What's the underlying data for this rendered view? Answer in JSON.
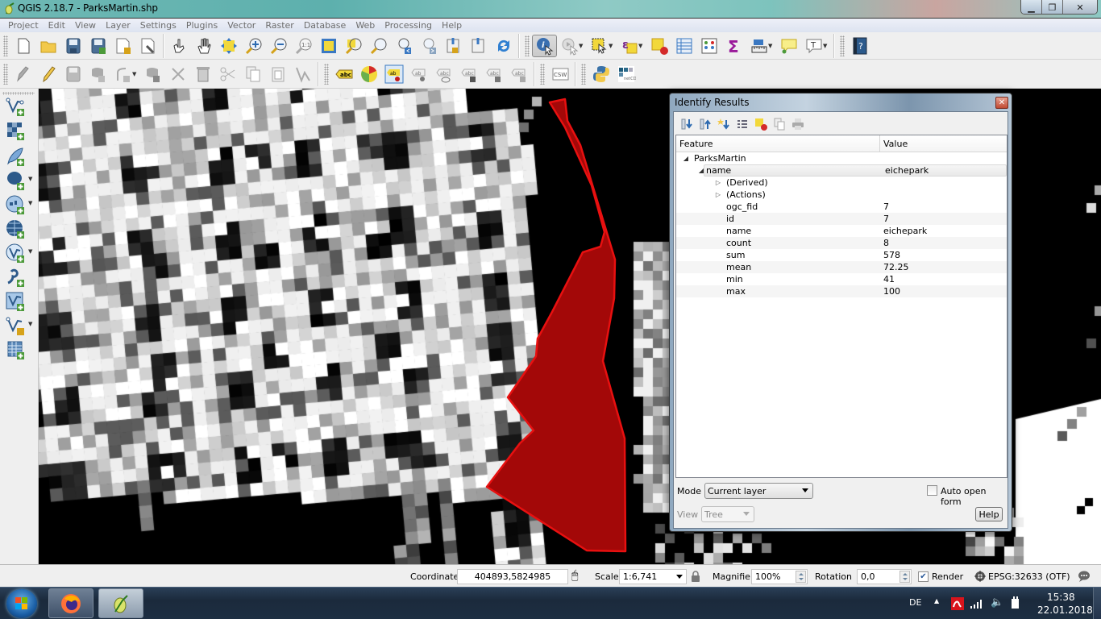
{
  "window": {
    "title": "QGIS 2.18.7 - ParksMartin.shp",
    "controls": [
      "minimize",
      "restore",
      "close"
    ]
  },
  "menubar": {
    "items": [
      "Project",
      "Edit",
      "View",
      "Layer",
      "Settings",
      "Plugins",
      "Vector",
      "Raster",
      "Database",
      "Web",
      "Processing",
      "Help"
    ]
  },
  "toolbar_top": {
    "icons": [
      "new-project-icon",
      "open-project-icon",
      "save-project-icon",
      "save-as-icon",
      "new-print-composer-icon",
      "composer-manager-icon",
      "touch-zoom-pan-icon",
      "pan-icon",
      "pan-to-selection-icon",
      "zoom-in-icon",
      "zoom-out-icon",
      "zoom-native-icon",
      "zoom-full-icon",
      "zoom-to-selection-icon",
      "zoom-to-layer-icon",
      "zoom-last-icon",
      "zoom-next-icon",
      "new-bookmark-icon",
      "show-bookmarks-icon",
      "refresh-icon",
      "identify-features-icon",
      "run-feature-action-icon",
      "select-features-icon",
      "select-by-expression-icon",
      "deselect-all-icon",
      "open-attribute-table-icon",
      "field-calculator-icon",
      "statistical-summary-icon",
      "measure-line-icon",
      "map-tips-icon",
      "text-annotation-icon",
      "help-icon"
    ]
  },
  "toolbar_second": {
    "icons": [
      "current-edits-icon",
      "toggle-editing-icon",
      "save-layer-edits-icon",
      "add-feature-icon",
      "node-tool-icon",
      "move-feature-icon",
      "delete-part-icon",
      "delete-selected-icon",
      "cut-features-icon",
      "copy-features-icon",
      "paste-features-icon",
      "digitize-icon",
      "label-layer-icon",
      "layer-labeling-options-icon",
      "pin-labels-icon",
      "highlight-pinned-labels-icon",
      "show-hide-labels-icon",
      "move-label-icon",
      "rotate-label-icon",
      "change-label-icon",
      "csw-icon",
      "python-console-icon",
      "netcdf-browser-icon"
    ],
    "csw_label": "CSW",
    "netcdf_label": "netCDF"
  },
  "toolbar_left": {
    "icons": [
      "add-vector-layer-icon",
      "add-raster-layer-icon",
      "add-spatialite-layer-icon",
      "add-postgis-layer-icon",
      "add-wms-layer-icon",
      "add-wcs-layer-icon",
      "add-wfs-layer-icon",
      "add-delimited-text-icon",
      "add-virtual-layer-icon",
      "new-shapefile-icon",
      "add-table-icon"
    ]
  },
  "identify": {
    "title": "Identify Results",
    "toolbar_icons": [
      "expand-tree-icon",
      "collapse-tree-icon",
      "expand-new-results-icon",
      "form-view-icon",
      "clear-results-icon",
      "copy-feature-icon",
      "print-icon"
    ],
    "columns": [
      "Feature",
      "Value"
    ],
    "layer": "ParksMartin",
    "feature_label": "name",
    "feature_value": "eichepark",
    "groups": [
      "(Derived)",
      "(Actions)"
    ],
    "attributes": [
      {
        "field": "ogc_fid",
        "value": "7"
      },
      {
        "field": "id",
        "value": "7"
      },
      {
        "field": "name",
        "value": "eichepark"
      },
      {
        "field": "count",
        "value": "8"
      },
      {
        "field": "sum",
        "value": "578"
      },
      {
        "field": "mean",
        "value": "72.25"
      },
      {
        "field": "min",
        "value": "41"
      },
      {
        "field": "max",
        "value": "100"
      }
    ],
    "mode_label": "Mode",
    "mode_value": "Current layer",
    "auto_open_form_label": "Auto open form",
    "auto_open_form_checked": false,
    "view_label": "View",
    "view_value": "Tree",
    "help_label": "Help"
  },
  "statusbar": {
    "coordinate_label": "Coordinate",
    "coordinate_value": "404893,5824985",
    "scale_label": "Scale",
    "scale_value": "1:6,741",
    "magnifier_label": "Magnifier",
    "magnifier_value": "100%",
    "rotation_label": "Rotation",
    "rotation_value": "0,0",
    "render_label": "Render",
    "render_checked": true,
    "crs_label": "EPSG:32633 (OTF)"
  },
  "taskbar": {
    "apps": [
      "Firefox",
      "QGIS"
    ],
    "language": "DE",
    "time": "15:38",
    "date": "22.01.2018"
  },
  "map": {
    "polygon_fill": "#a30808",
    "polygon_stroke": "#e81010",
    "raster": "grayscale"
  }
}
